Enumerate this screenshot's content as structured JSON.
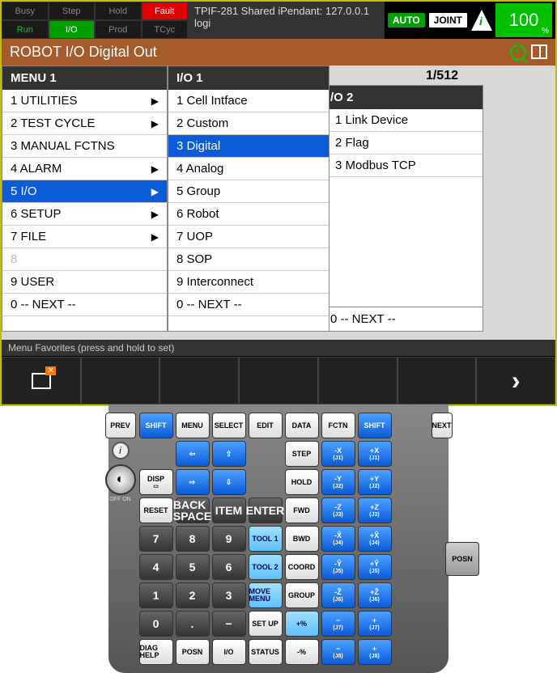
{
  "status": {
    "cells": [
      "Busy",
      "Step",
      "Hold",
      "Fault",
      "Run",
      "I/O",
      "Prod",
      "TCyc"
    ],
    "title": "TPIF-281 Shared iPendant: 127.0.0.1 logi",
    "auto": "AUTO",
    "joint": "JOINT",
    "pct": "100",
    "pct_unit": "%"
  },
  "titlebar": "ROBOT I/O Digital Out",
  "counter": "1/512",
  "brackets": [
    "]",
    "]",
    "]",
    "]",
    "]",
    "]",
    "]",
    "]"
  ],
  "menu1": {
    "header": "MENU  1",
    "items": [
      {
        "n": "1",
        "t": "UTILITIES",
        "a": true
      },
      {
        "n": "2",
        "t": "TEST CYCLE",
        "a": true
      },
      {
        "n": "3",
        "t": "MANUAL FCTNS",
        "a": false
      },
      {
        "n": "4",
        "t": "ALARM",
        "a": true
      },
      {
        "n": "5",
        "t": "I/O",
        "a": true,
        "sel": true
      },
      {
        "n": "6",
        "t": "SETUP",
        "a": true
      },
      {
        "n": "7",
        "t": "FILE",
        "a": true
      },
      {
        "n": "8",
        "t": "",
        "dis": true
      },
      {
        "n": "9",
        "t": "USER",
        "a": false
      },
      {
        "n": "0",
        "t": "-- NEXT --",
        "a": false
      }
    ]
  },
  "menu2": {
    "header": "I/O  1",
    "items": [
      {
        "n": "1",
        "t": "Cell Intface"
      },
      {
        "n": "2",
        "t": "Custom"
      },
      {
        "n": "3",
        "t": "Digital",
        "sel": true
      },
      {
        "n": "4",
        "t": "Analog"
      },
      {
        "n": "5",
        "t": "Group"
      },
      {
        "n": "6",
        "t": "Robot"
      },
      {
        "n": "7",
        "t": "UOP"
      },
      {
        "n": "8",
        "t": "SOP"
      },
      {
        "n": "9",
        "t": "Interconnect"
      },
      {
        "n": "0",
        "t": "-- NEXT --"
      }
    ]
  },
  "menu3": {
    "header": "/O  2",
    "items": [
      {
        "n": "1",
        "t": "Link Device"
      },
      {
        "n": "2",
        "t": "Flag"
      },
      {
        "n": "3",
        "t": "Modbus TCP"
      }
    ],
    "next": "0 -- NEXT --"
  },
  "fav_label": "Menu Favorites (press and hold to set)",
  "keys": {
    "r1": [
      "PREV",
      "SHIFT",
      "MENU",
      "SELECT",
      "EDIT",
      "DATA",
      "FCTN",
      "SHIFT",
      "NEXT"
    ],
    "disp": "DISP",
    "reset": "RESET",
    "step": "STEP",
    "hold": "HOLD",
    "fwd": "FWD",
    "bwd": "BWD",
    "coord": "COORD",
    "group": "GROUP",
    "backspace": "BACK SPACE",
    "item": "ITEM",
    "enter": "ENTER",
    "tool1": "TOOL 1",
    "tool2": "TOOL 2",
    "movemenu": "MOVE MENU",
    "setup": "SET UP",
    "status": "STATUS",
    "diaghelp": "DIAG HELP",
    "posn": "POSN",
    "io": "I/O",
    "posn_side": "POSN",
    "onoff": "OFF   ON",
    "jog": [
      {
        "a": "-X",
        "b": "(J1)"
      },
      {
        "a": "+X",
        "b": "(J1)"
      },
      {
        "a": "-Y",
        "b": "(J2)"
      },
      {
        "a": "+Y",
        "b": "(J2)"
      },
      {
        "a": "-Z",
        "b": "(J3)"
      },
      {
        "a": "+Z",
        "b": "(J3)"
      },
      {
        "a": "-X̂",
        "b": "(J4)"
      },
      {
        "a": "+X̂",
        "b": "(J4)"
      },
      {
        "a": "-Ŷ",
        "b": "(J5)"
      },
      {
        "a": "+Ŷ",
        "b": "(J5)"
      },
      {
        "a": "-Ẑ",
        "b": "(J6)"
      },
      {
        "a": "+Ẑ",
        "b": "(J6)"
      },
      {
        "a": "−",
        "b": "(J7)"
      },
      {
        "a": "+",
        "b": "(J7)"
      },
      {
        "a": "−",
        "b": "(J8)"
      },
      {
        "a": "+",
        "b": "(J8)"
      }
    ],
    "nums": [
      "7",
      "8",
      "9",
      "4",
      "5",
      "6",
      "1",
      "2",
      "3",
      "0",
      ".",
      "−"
    ],
    "pctplus": "+%",
    "pctminus": "-%"
  }
}
